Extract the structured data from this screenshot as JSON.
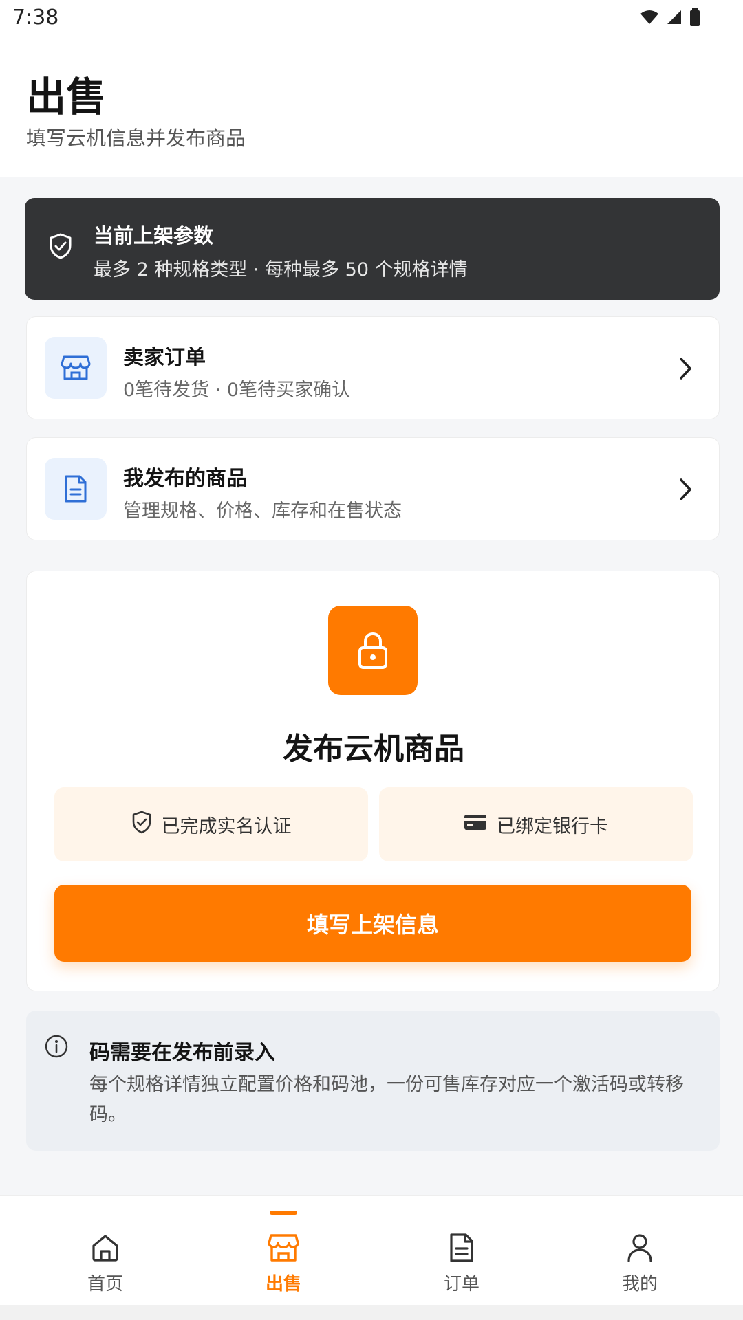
{
  "status_bar": {
    "time": "7:38"
  },
  "header": {
    "title": "出售",
    "subtitle": "填写云机信息并发布商品"
  },
  "notice": {
    "title": "当前上架参数",
    "desc": "最多 2 种规格类型 · 每种最多 50 个规格详情"
  },
  "seller_orders": {
    "title": "卖家订单",
    "desc": "0笔待发货 · 0笔待买家确认"
  },
  "my_products": {
    "title": "我发布的商品",
    "desc": "管理规格、价格、库存和在售状态"
  },
  "publish": {
    "title": "发布云机商品",
    "verified_label": "已完成实名认证",
    "bank_label": "已绑定银行卡",
    "cta_label": "填写上架信息"
  },
  "info": {
    "title": "码需要在发布前录入",
    "desc": "每个规格详情独立配置价格和码池，一份可售库存对应一个激活码或转移码。"
  },
  "tabbar": {
    "items": [
      {
        "label": "首页",
        "icon": "home-icon"
      },
      {
        "label": "出售",
        "icon": "store-icon"
      },
      {
        "label": "订单",
        "icon": "document-icon"
      },
      {
        "label": "我的",
        "icon": "person-icon"
      }
    ],
    "active_index": 1
  },
  "colors": {
    "accent": "#ff7a00",
    "dark_notice": "#333436",
    "icon_blue": "#2f6fd6"
  }
}
